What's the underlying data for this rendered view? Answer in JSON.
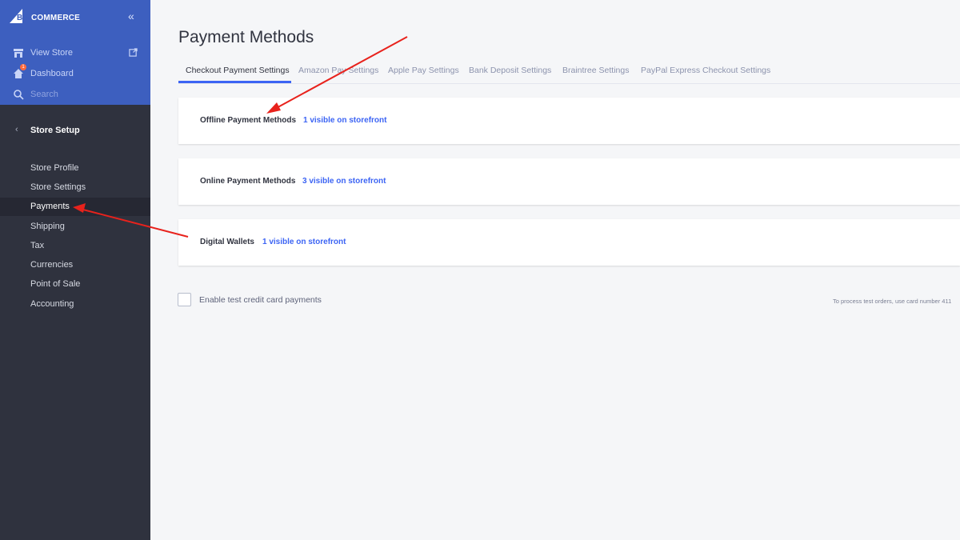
{
  "brand": {
    "logo_big": "BIG",
    "logo_commerce": "COMMERCE"
  },
  "sidebar": {
    "top_items": [
      {
        "label": "View Store",
        "icon": "store-icon"
      },
      {
        "label": "Dashboard",
        "icon": "home-icon",
        "badge": "1"
      },
      {
        "label": "Search",
        "icon": "search-icon"
      }
    ],
    "section_label": "Store Setup",
    "items": [
      {
        "label": "Store Profile"
      },
      {
        "label": "Store Settings"
      },
      {
        "label": "Payments",
        "active": true
      },
      {
        "label": "Shipping"
      },
      {
        "label": "Tax"
      },
      {
        "label": "Currencies"
      },
      {
        "label": "Point of Sale"
      },
      {
        "label": "Accounting"
      }
    ]
  },
  "main": {
    "title": "Payment Methods",
    "tabs": [
      {
        "label": "Checkout Payment Settings",
        "active": true
      },
      {
        "label": "Amazon Pay Settings"
      },
      {
        "label": "Apple Pay Settings"
      },
      {
        "label": "Bank Deposit Settings"
      },
      {
        "label": "Braintree Settings"
      },
      {
        "label": "PayPal Express Checkout Settings"
      }
    ],
    "cards": [
      {
        "name": "Offline Payment Methods",
        "visible": "1 visible on storefront"
      },
      {
        "name": "Online Payment Methods",
        "visible": "3 visible on storefront"
      },
      {
        "name": "Digital Wallets",
        "visible": "1 visible on storefront"
      }
    ],
    "test_checkbox_label": "Enable test credit card payments",
    "test_hint": "To process test orders, use card number 411"
  },
  "colors": {
    "sidebar_top": "#3d5fbf",
    "sidebar_bg": "#2f323e",
    "accent": "#3c64f4",
    "annotation_arrow": "#e8221c"
  }
}
